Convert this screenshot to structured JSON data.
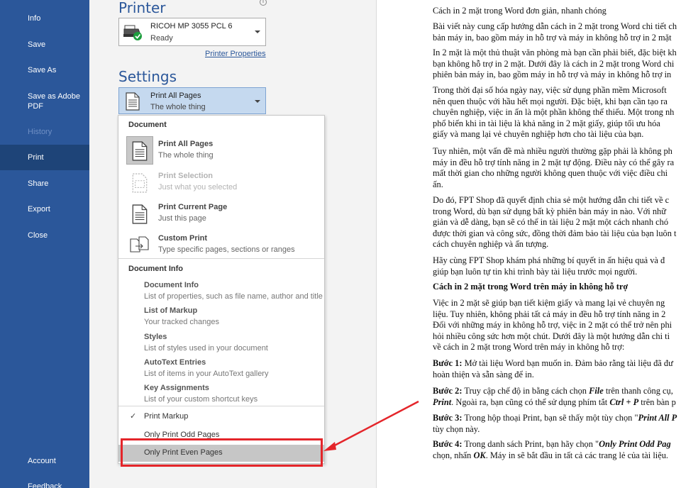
{
  "sidebar": {
    "items": [
      {
        "label": "Info"
      },
      {
        "label": "Save"
      },
      {
        "label": "Save As"
      },
      {
        "label": "Save as Adobe PDF"
      },
      {
        "label": "History"
      },
      {
        "label": "Print"
      },
      {
        "label": "Share"
      },
      {
        "label": "Export"
      },
      {
        "label": "Close"
      }
    ],
    "bottom": [
      {
        "label": "Account"
      },
      {
        "label": "Feedback"
      }
    ]
  },
  "printer": {
    "heading": "Printer",
    "name": "RICOH MP 3055 PCL 6",
    "status": "Ready",
    "properties_link": "Printer Properties"
  },
  "settings": {
    "heading": "Settings",
    "selected_title": "Print All Pages",
    "selected_sub": "The whole thing"
  },
  "menu": {
    "document_title": "Document",
    "items": [
      {
        "title": "Print All Pages",
        "sub": "The whole thing"
      },
      {
        "title": "Print Selection",
        "sub": "Just what you selected"
      },
      {
        "title": "Print Current Page",
        "sub": "Just this page"
      },
      {
        "title": "Custom Print",
        "sub": "Type specific pages, sections or ranges"
      }
    ],
    "docinfo_title": "Document Info",
    "docinfo": [
      {
        "title": "Document Info",
        "sub": "List of properties, such as file name, author and title"
      },
      {
        "title": "List of Markup",
        "sub": "Your tracked changes"
      },
      {
        "title": "Styles",
        "sub": "List of styles used in your document"
      },
      {
        "title": "AutoText Entries",
        "sub": "List of items in your AutoText gallery"
      },
      {
        "title": "Key Assignments",
        "sub": "List of your custom shortcut keys"
      }
    ],
    "options": [
      {
        "label": "Print Markup",
        "checked": "✓"
      },
      {
        "label": "Only Print Odd Pages"
      },
      {
        "label": "Only Print Even Pages"
      }
    ]
  },
  "document": {
    "title": "Cách in 2 mặt trong Word đơn giản, nhanh chóng",
    "p1": [
      "Bài viết này cung cấp hướng dẫn cách in 2 mặt trong Word chi tiết ch",
      "bản máy in, bao gồm máy in hỗ trợ và máy in không hỗ trợ in 2 mặt"
    ],
    "p2": [
      "In 2 mặt là một thủ thuật văn phòng mà bạn cần phải biết, đặc biệt kh",
      "bạn không hỗ trợ in 2 mặt. Dưới đây là cách in 2 mặt trong Word chi",
      "phiên bản máy in, bao gồm máy in hỗ trợ và máy in không hỗ trợ in"
    ],
    "p3": [
      "Trong thời đại số hóa ngày nay, việc sử dụng phần mềm Microsoft",
      "nên quen thuộc với hầu hết mọi người. Đặc biệt, khi bạn cần tạo ra",
      "chuyên nghiệp, việc in ấn là một phần không thể thiếu. Một trong nh",
      "phổ biến khi in tài liệu là khả năng in 2 mặt giấy, giúp tối ưu hóa",
      "giấy và mang lại vẻ chuyên nghiệp hơn cho tài liệu của bạn."
    ],
    "p4": [
      "Tuy nhiên, một vấn đề mà nhiều người thường gặp phải là không ph",
      "máy in đều hỗ trợ tính năng in 2 mặt tự động. Điều này có thể gây ra",
      "mất thời gian cho những người không quen thuộc với việc điều chi",
      "ấn."
    ],
    "p5": [
      "Do đó, FPT Shop đã quyết định chia sẻ một hướng dẫn chi tiết về c",
      "trong Word, dù bạn sử dụng bất kỳ phiên bản máy in nào. Với nhữ",
      "giản và dễ dàng, bạn sẽ có thể in tài liệu 2 mặt một cách nhanh chó",
      "được thời gian và công sức, đồng thời đảm bảo tài liệu của bạn luôn t",
      "cách chuyên nghiệp và ấn tượng."
    ],
    "p6": [
      "Hãy cùng FPT Shop khám phá những bí quyết in ấn hiệu quả và đ",
      "giúp bạn luôn tự tin khi trình bày tài liệu trước mọi người."
    ],
    "h2": "Cách in 2 mặt trong Word trên máy in không hỗ trợ",
    "p7": [
      "Việc in 2 mặt sẽ giúp bạn tiết kiệm giấy và mang lại vẻ chuyên ng",
      "liệu. Tuy nhiên, không phải tất cả máy in đều hỗ trợ tính năng in 2",
      "Đối với những máy in không hỗ trợ, việc in 2 mặt có thể trở nên phi",
      "hỏi nhiều công sức hơn một chút. Dưới đây là một hướng dẫn chi ti",
      "về cách in 2 mặt trong Word trên máy in không hỗ trợ:"
    ],
    "s1": {
      "label": "Bước 1:",
      "text": " Mở tài liệu Word bạn muốn in. Đảm bảo rằng tài liệu đã đư",
      "line2": "hoàn thiện và sẵn sàng để in."
    },
    "s2": {
      "label": "Bước 2:",
      "text_a": " Truy cập chế độ in bằng cách chọn ",
      "file": "File",
      "text_b": " trên thanh công cụ,",
      "print": "Print",
      "text_c": ". Ngoài ra, bạn cũng có thể sử dụng phím tắt ",
      "shortcut": "Ctrl + P",
      "text_d": " trên bàn p"
    },
    "s3": {
      "label": "Bước 3:",
      "text": " Trong hộp thoại Print, bạn sẽ thấy một tùy chọn \"",
      "em": "Print All P",
      "line2": "tùy chọn này."
    },
    "s4": {
      "label": "Bước 4:",
      "text": " Trong danh sách Print, bạn hãy chọn \"",
      "em": "Only Print Odd Pag",
      "line2a": "chọn, nhấn ",
      "ok": "OK",
      "line2b": ". Máy in sẽ bắt đầu in tất cả các trang lẻ của tài liệu."
    }
  },
  "colors": {
    "sidebar": "#2b579a",
    "accent": "#2b579a",
    "highlight": "#e4252a"
  }
}
